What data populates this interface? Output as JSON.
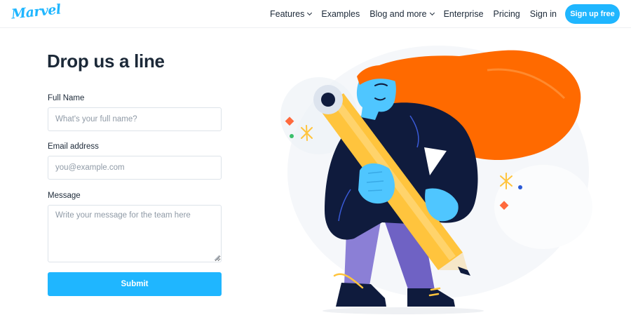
{
  "header": {
    "logo_text": "Marvel",
    "nav": [
      {
        "label": "Features",
        "has_dropdown": true
      },
      {
        "label": "Examples",
        "has_dropdown": false
      },
      {
        "label": "Blog and more",
        "has_dropdown": true
      },
      {
        "label": "Enterprise",
        "has_dropdown": false
      },
      {
        "label": "Pricing",
        "has_dropdown": false
      },
      {
        "label": "Sign in",
        "has_dropdown": false
      }
    ],
    "signup_label": "Sign up free"
  },
  "form": {
    "title": "Drop us a line",
    "full_name": {
      "label": "Full Name",
      "placeholder": "What's your full name?",
      "value": ""
    },
    "email": {
      "label": "Email address",
      "placeholder": "you@example.com",
      "value": ""
    },
    "message": {
      "label": "Message",
      "placeholder": "Write your message for the team here",
      "value": ""
    },
    "submit_label": "Submit"
  },
  "colors": {
    "accent": "#1fb6ff",
    "text": "#1c2938",
    "hair": "#ff6a00",
    "pencil": "#ffc43d",
    "jacket": "#0f1b3d",
    "skin": "#4fc6ff",
    "pants": "#8b7fd6"
  },
  "icons": [
    "chevron-down-icon",
    "resize-grip-icon"
  ]
}
